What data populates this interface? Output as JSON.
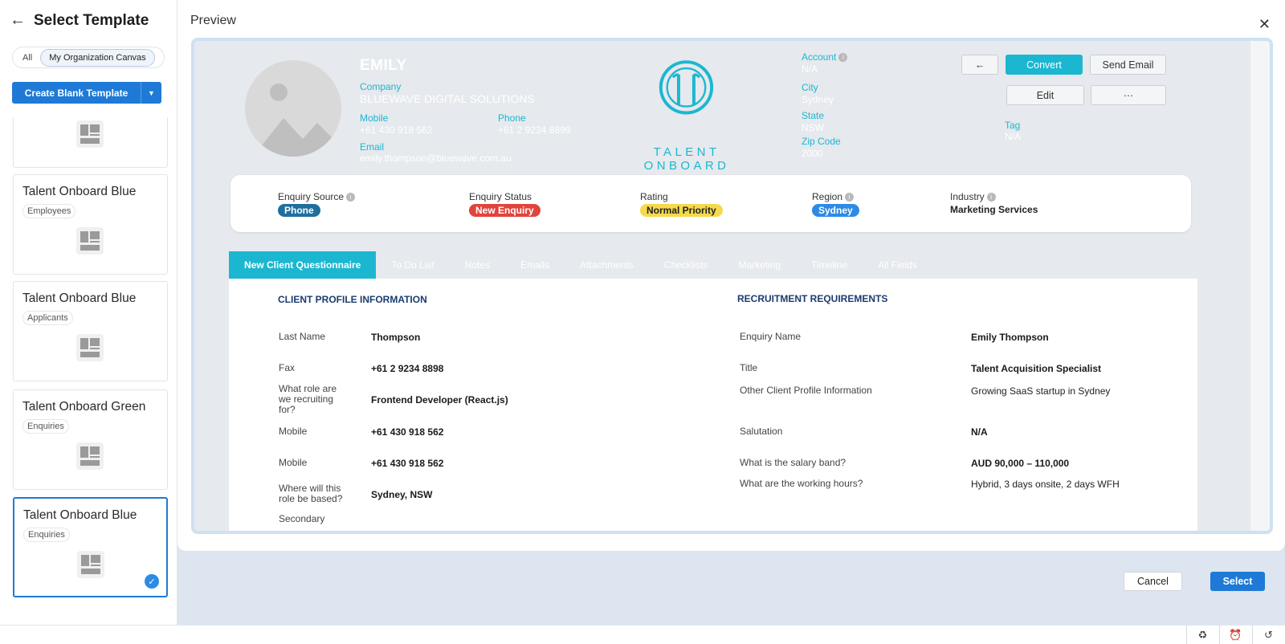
{
  "sidebar": {
    "title": "Select Template",
    "toggle": {
      "all": "All",
      "org": "My Organization Canvas"
    },
    "create_label": "Create Blank Template",
    "cards": [
      {
        "title": "",
        "tag": ""
      },
      {
        "title": "Talent Onboard Blue",
        "tag": "Employees"
      },
      {
        "title": "Talent Onboard Blue",
        "tag": "Applicants"
      },
      {
        "title": "Talent Onboard Green",
        "tag": "Enquiries"
      },
      {
        "title": "Talent Onboard Blue",
        "tag": "Enquiries"
      }
    ]
  },
  "preview": {
    "label": "Preview",
    "hero": {
      "name": "EMILY",
      "company_label": "Company",
      "company": "BLUEWAVE DIGITAL SOLUTIONS",
      "mobile_label": "Mobile",
      "mobile": "+61 430 918 562",
      "phone_label": "Phone",
      "phone": "+61 2 9234 8899",
      "email_label": "Email",
      "email": "emily.thompson@bluewave.com.au",
      "logo_text": "TALENT ONBOARD",
      "account_label": "Account",
      "account": "N/A",
      "city_label": "City",
      "city": "Sydney",
      "state_label": "State",
      "state": "NSW",
      "zip_label": "Zip Code",
      "zip": "2000",
      "tag_label": "Tag",
      "tag": "N/A",
      "buttons": {
        "back": "←",
        "convert": "Convert",
        "send_email": "Send Email",
        "edit": "Edit",
        "more": "···"
      }
    },
    "summary": {
      "enquiry_source_label": "Enquiry Source",
      "enquiry_source": "Phone",
      "enquiry_status_label": "Enquiry Status",
      "enquiry_status": "New Enquiry",
      "rating_label": "Rating",
      "rating": "Normal Priority",
      "region_label": "Region",
      "region": "Sydney",
      "industry_label": "Industry",
      "industry": "Marketing Services"
    },
    "tabs": [
      "New Client Questionnaire",
      "To Do List",
      "Notes",
      "Emails",
      "Attachments",
      "Checklists",
      "Marketing",
      "Timeline",
      "All Fields"
    ],
    "client_profile": {
      "title": "CLIENT PROFILE INFORMATION",
      "fields": [
        {
          "label": "Last Name",
          "value": "Thompson"
        },
        {
          "label": "Fax",
          "value": "+61 2 9234 8898"
        },
        {
          "label": "What role are we recruiting for?",
          "value": "Frontend Developer (React.js)"
        },
        {
          "label": "Mobile",
          "value": "+61 430 918 562"
        },
        {
          "label": "Mobile",
          "value": "+61 430 918 562"
        },
        {
          "label": "Where will this role be based?",
          "value": "Sydney, NSW"
        },
        {
          "label": "Secondary",
          "value": ""
        }
      ]
    },
    "recruitment": {
      "title": "RECRUITMENT REQUIREMENTS",
      "fields": [
        {
          "label": "Enquiry Name",
          "value": "Emily Thompson"
        },
        {
          "label": "Title",
          "value": "Talent Acquisition Specialist"
        },
        {
          "label": "Other Client Profile Information",
          "value": "Growing SaaS startup in Sydney"
        },
        {
          "label": "Salutation",
          "value": "N/A"
        },
        {
          "label": "What is the salary band?",
          "value": "AUD 90,000 – 110,000"
        },
        {
          "label": "What are the working hours?",
          "value": "Hybrid, 3 days onsite, 2 days WFH"
        }
      ]
    }
  },
  "footer": {
    "cancel": "Cancel",
    "select": "Select"
  },
  "colors": {
    "primary": "#1e7ad6",
    "accent": "#1bb7d1",
    "phone_pill": "#1f6f9e",
    "status_pill": "#e0443c",
    "rating_pill": "#f6d94c",
    "region_pill": "#2c8be6"
  },
  "icons": [
    "back-arrow-icon",
    "close-icon",
    "template-thumbnail-icon",
    "check-icon",
    "info-icon",
    "recycle-icon",
    "alarm-clock-icon",
    "history-icon"
  ]
}
